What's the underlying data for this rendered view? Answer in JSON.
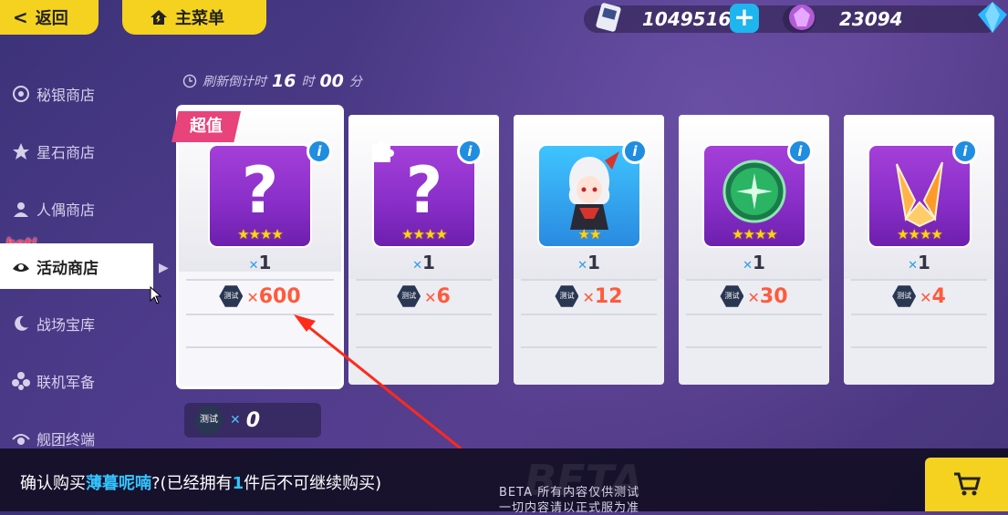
{
  "header": {
    "back_label": "返回",
    "main_menu_label": "主菜单",
    "crystals": "1049516",
    "stones": "23094"
  },
  "sidebar": {
    "hot_tag": "hot!",
    "items": [
      {
        "label": "秘银商店",
        "icon": "mithril-icon"
      },
      {
        "label": "星石商店",
        "icon": "star-stone-icon"
      },
      {
        "label": "人偶商店",
        "icon": "doll-icon"
      },
      {
        "label": "活动商店",
        "icon": "event-icon",
        "active": true
      },
      {
        "label": "战场宝库",
        "icon": "moon-icon"
      },
      {
        "label": "联机军备",
        "icon": "flower-icon"
      },
      {
        "label": "舰团终端",
        "icon": "terminal-icon"
      }
    ]
  },
  "timer": {
    "prefix": "刷新倒计时",
    "hours": "16",
    "hours_unit": "时",
    "minutes": "00",
    "minutes_unit": "分"
  },
  "cards": [
    {
      "tag": "超值",
      "quantity": "1",
      "price": "600",
      "stars": "★★★★",
      "currency_label": "测试"
    },
    {
      "quantity": "1",
      "price": "6",
      "stars": "★★★★",
      "currency_label": "测试"
    },
    {
      "quantity": "1",
      "price": "12",
      "stars": "★★",
      "currency_label": "测试"
    },
    {
      "quantity": "1",
      "price": "30",
      "stars": "★★★★",
      "currency_label": "测试"
    },
    {
      "quantity": "1",
      "price": "4",
      "stars": "★★★★",
      "currency_label": "测试"
    }
  ],
  "owned": {
    "currency_label": "测试",
    "value": "0"
  },
  "footer": {
    "confirm_prefix": "确认购买",
    "item_name": "薄暮呢喃",
    "confirm_mid": "?(已经拥有",
    "owned_count": "1",
    "confirm_suffix": "件后不可继续购买)",
    "beta_line1": "BETA 所有内容仅供测试",
    "beta_line2": "一切内容请以正式服为准",
    "beta_watermark": "BETA"
  },
  "colors": {
    "accent_yellow": "#f4d21f",
    "price_red": "#ff5a3c",
    "highlight_blue": "#33c4ff",
    "super_tag_pink": "#e8437a"
  }
}
